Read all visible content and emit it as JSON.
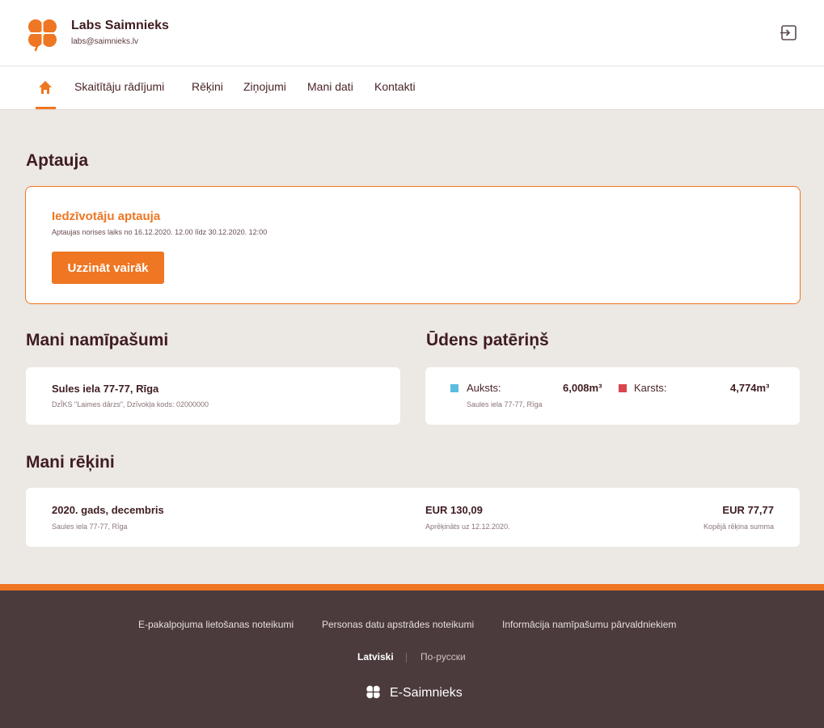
{
  "header": {
    "user_name": "Labs Saimnieks",
    "user_email": "labs@saimnieks.lv"
  },
  "nav": {
    "items": [
      "Skaitītāju rādījumi",
      "Rēķini",
      "Ziņojumi",
      "Mani dati",
      "Kontakti"
    ]
  },
  "survey": {
    "section_title": "Aptauja",
    "title": "Iedzīvotāju aptauja",
    "subtitle": "Aptaujas norises laiks no 16.12.2020. 12.00 līdz 30.12.2020. 12:00",
    "button": "Uzzināt vairāk"
  },
  "properties": {
    "section_title": "Mani namīpašumi",
    "address": "Sules iela 77-77, Rīga",
    "details": "DzĪKS \"Laimes dārzs\", Dzīvokļa kods: 02000000"
  },
  "water": {
    "section_title": "Ūdens patēriņš",
    "cold_label": "Auksts:",
    "cold_value": "6,008m³",
    "hot_label": "Karsts:",
    "hot_value": "4,774m³",
    "address": "Saules iela 77-77, Rīga",
    "colors": {
      "cold": "#5bbde0",
      "hot": "#d9454d"
    }
  },
  "bills": {
    "section_title": "Mani rēķini",
    "period": "2020. gads, decembris",
    "address": "Saules iela 77-77, Rīga",
    "calc_amount": "EUR 130,09",
    "calc_note": "Aprēķināts uz 12.12.2020.",
    "total_amount": "EUR 77,77",
    "total_note": "Kopējā rēķina summa"
  },
  "footer": {
    "links": [
      "E-pakalpojuma lietošanas noteikumi",
      "Personas datu apstrādes noteikumi",
      "Informācija namīpašumu pārvaldniekiem"
    ],
    "lang_active": "Latviski",
    "lang_other": "По-русски",
    "brand": "E-Saimnieks"
  },
  "colors": {
    "accent": "#ef7622",
    "footer": "#4b3b3c",
    "background": "#ece8e3"
  },
  "icons": [
    "clover-logo-icon",
    "logout-icon",
    "home-icon"
  ]
}
